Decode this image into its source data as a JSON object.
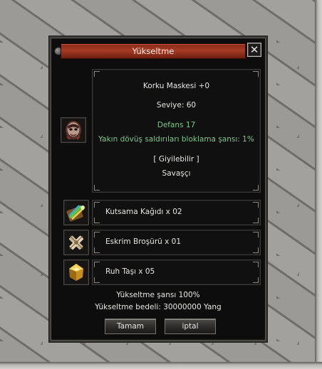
{
  "window": {
    "title": "Yükseltme",
    "close_label": "✕"
  },
  "item": {
    "name": "Korku Maskesi +0",
    "level": "Seviye: 60",
    "defense": "Defans 17",
    "bonus": "Yakın dövüş saldırıları bloklama şansı: 1%",
    "wearable": "[ Giyilebilir ]",
    "class": "Savaşçı",
    "icon": "mask-icon"
  },
  "materials": [
    {
      "label": "Kutsama Kağıdı x 02",
      "icon": "scroll-icon"
    },
    {
      "label": "Eskrim Broşürü x 01",
      "icon": "crossed-swords-icon"
    },
    {
      "label": "Ruh Taşı x 05",
      "icon": "gold-stone-icon"
    }
  ],
  "summary": {
    "chance": "Yükseltme şansı 100%",
    "cost": "Yükseltme bedeli: 30000000 Yang"
  },
  "buttons": {
    "ok": "Tamam",
    "cancel": "iptal"
  },
  "colors": {
    "title_bar": "#a63b24",
    "text": "#e9e6e1",
    "stat_green": "#7ec78a"
  }
}
